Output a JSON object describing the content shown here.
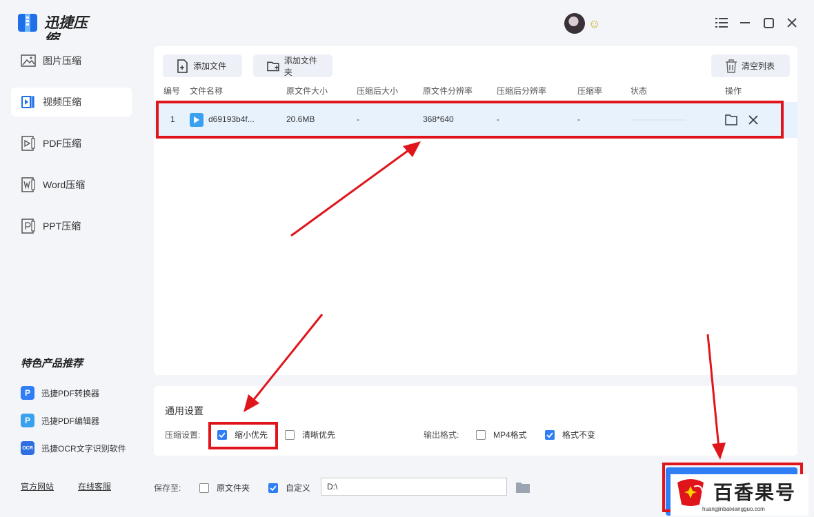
{
  "app": {
    "title": "迅捷压缩"
  },
  "sidebar": {
    "items": [
      {
        "label": "图片压缩",
        "icon": "image-icon",
        "active": false
      },
      {
        "label": "视频压缩",
        "icon": "video-icon",
        "active": true
      },
      {
        "label": "PDF压缩",
        "icon": "pdf-icon",
        "active": false
      },
      {
        "label": "Word压缩",
        "icon": "word-icon",
        "active": false
      },
      {
        "label": "PPT压缩",
        "icon": "ppt-icon",
        "active": false
      }
    ],
    "promo_title": "特色产品推荐",
    "promos": [
      {
        "label": "迅捷PDF转换器",
        "icon": "pdf-converter-icon",
        "color": "#2f7ef5"
      },
      {
        "label": "迅捷PDF编辑器",
        "icon": "pdf-editor-icon",
        "color": "#3aa0f0"
      },
      {
        "label": "迅捷OCR文字识别软件",
        "icon": "ocr-icon",
        "color": "#2f6fe0"
      }
    ],
    "footer_links": [
      "官方网站",
      "在线客服"
    ]
  },
  "toolbar": {
    "add_file": "添加文件",
    "add_folder": "添加文件夹",
    "clear_list": "清空列表"
  },
  "table": {
    "columns": [
      "编号",
      "文件名称",
      "原文件大小",
      "压缩后大小",
      "原文件分辨率",
      "压缩后分辨率",
      "压缩率",
      "状态",
      "操作"
    ],
    "rows": [
      {
        "no": "1",
        "name": "d69193b4f...",
        "orig_size": "20.6MB",
        "comp_size": "-",
        "orig_res": "368*640",
        "comp_res": "-",
        "ratio": "-",
        "status": ""
      }
    ]
  },
  "settings": {
    "title": "通用设置",
    "compress_label": "压缩设置:",
    "opt_small": "缩小优先",
    "opt_clear": "清晰优先",
    "format_label": "输出格式:",
    "opt_mp4": "MP4格式",
    "opt_keep": "格式不变",
    "checked": {
      "small": true,
      "clear": false,
      "mp4": false,
      "keep": true
    }
  },
  "save": {
    "label": "保存至:",
    "opt_orig": "原文件夹",
    "opt_custom": "自定义",
    "path": "D:\\",
    "checked": {
      "orig": false,
      "custom": true
    }
  },
  "watermark": {
    "text": "百香果号",
    "url": "huangjinbaixiangguo.com"
  },
  "colors": {
    "accent": "#2f7ef5",
    "annotation": "#e0151b",
    "row_highlight": "#e8f2fd"
  }
}
